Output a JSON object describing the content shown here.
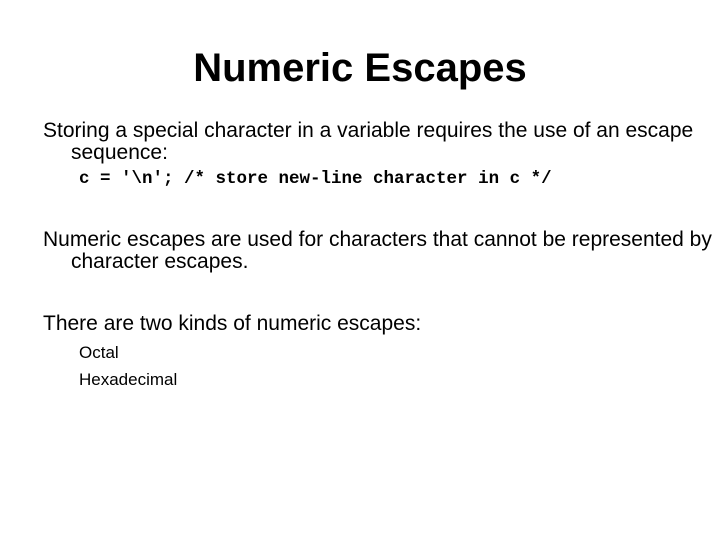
{
  "slide": {
    "title": "Numeric Escapes",
    "paragraphs": [
      "Storing a special character in a variable requires the use of an escape sequence:",
      "Numeric escapes are used for characters that cannot be represented by character escapes.",
      "There are two kinds of numeric escapes:"
    ],
    "code_example": "c = '\\n'; /* store new-line character in c */",
    "sub_items": [
      "Octal",
      "Hexadecimal"
    ]
  }
}
